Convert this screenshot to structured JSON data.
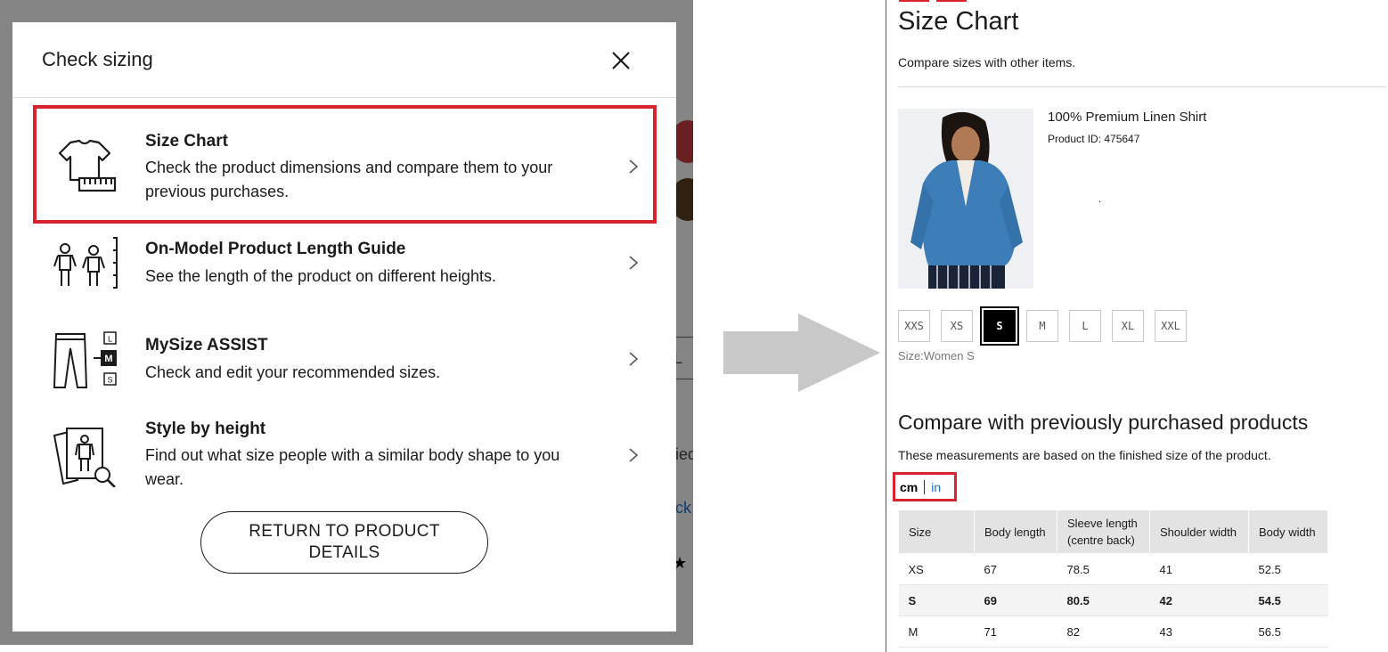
{
  "modal": {
    "title": "Check sizing",
    "options": [
      {
        "title": "Size Chart",
        "description": "Check the product dimensions and compare them to your previous purchases."
      },
      {
        "title": "On-Model Product Length Guide",
        "description": "See the length of the product on different heights."
      },
      {
        "title": "MySize ASSIST",
        "description": "Check and edit your recommended sizes."
      },
      {
        "title": "Style by height",
        "description": "Find out what size people with a similar body shape to you wear."
      }
    ],
    "return_button": "RETURN TO PRODUCT DETAILS",
    "mysize_icon_letters": [
      "L",
      "M",
      "S"
    ]
  },
  "background_fragments": {
    "l": "L",
    "ied": "ied",
    "ck": "ck",
    "star": "★"
  },
  "size_chart": {
    "title": "Size Chart",
    "subtitle": "Compare sizes with other items.",
    "product": {
      "name": "100% Premium Linen Shirt",
      "id": "Product ID: 475647",
      "dot": "."
    },
    "sizes": [
      "XXS",
      "XS",
      "S",
      "M",
      "L",
      "XL",
      "XXL"
    ],
    "selected_size": "S",
    "size_label": "Size:Women S",
    "compare_title": "Compare with previously purchased products",
    "compare_subtitle": "These measurements are based on the finished size of the product.",
    "units": {
      "cm": "cm",
      "in": "in",
      "active": "cm"
    },
    "table": {
      "headers": [
        "Size",
        "Body length",
        "Sleeve length (centre back)",
        "Shoulder width",
        "Body width"
      ],
      "rows": [
        [
          "XS",
          "67",
          "78.5",
          "41",
          "52.5"
        ],
        [
          "S",
          "69",
          "80.5",
          "42",
          "54.5"
        ],
        [
          "M",
          "71",
          "82",
          "43",
          "56.5"
        ]
      ]
    }
  },
  "colors": {
    "highlight": "#d9232e",
    "link": "#1f6fd1",
    "arrow": "#c8c8c8"
  }
}
